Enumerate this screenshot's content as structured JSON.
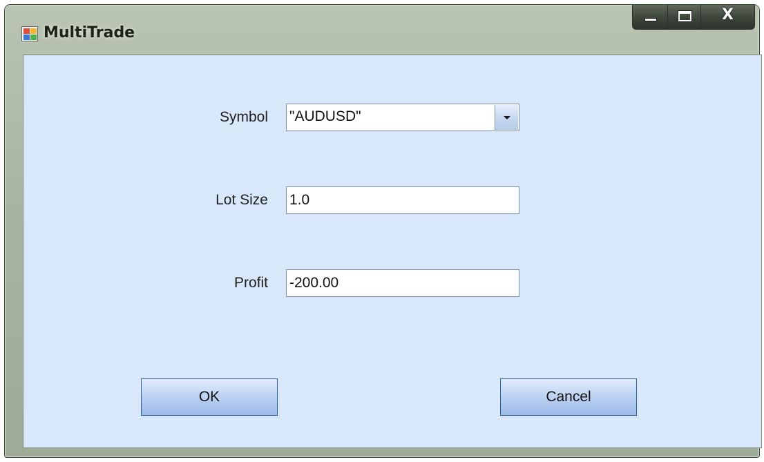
{
  "window": {
    "title": "MultiTrade",
    "icon": "app-window-icon",
    "caption_buttons": {
      "minimize_icon": "minimize-icon",
      "maximize_icon": "maximize-icon",
      "close_label": "X"
    }
  },
  "form": {
    "symbol": {
      "label": "Symbol",
      "value": "\"AUDUSD\""
    },
    "lot_size": {
      "label": "Lot Size",
      "value": "1.0"
    },
    "profit": {
      "label": "Profit",
      "value": "-200.00"
    }
  },
  "buttons": {
    "ok_label": "OK",
    "cancel_label": "Cancel"
  },
  "colors": {
    "client_background": "#d9e7fa",
    "frame": "#a8b4a1",
    "button_border": "#2d5f9b"
  }
}
